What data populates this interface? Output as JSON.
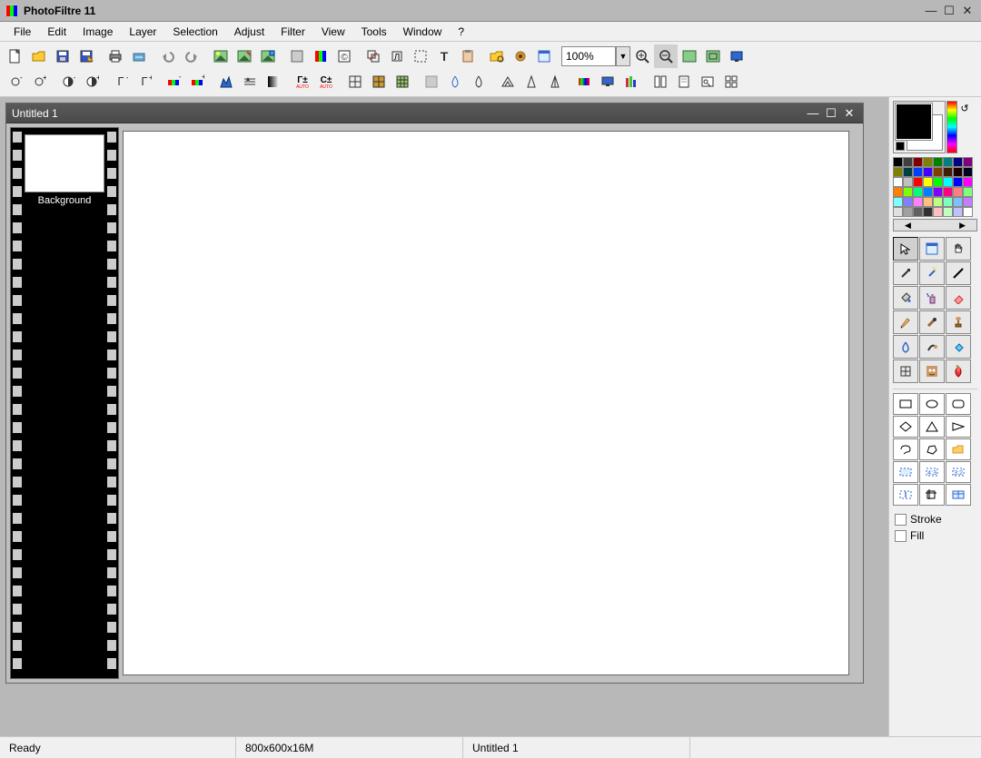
{
  "app": {
    "title": "PhotoFiltre 11"
  },
  "menu": [
    "File",
    "Edit",
    "Image",
    "Layer",
    "Selection",
    "Adjust",
    "Filter",
    "View",
    "Tools",
    "Window",
    "?"
  ],
  "toolbar": {
    "zoom": "100%"
  },
  "document": {
    "title": "Untitled 1",
    "layer_label": "Background"
  },
  "side": {
    "stroke_label": "Stroke",
    "fill_label": "Fill"
  },
  "status": {
    "ready": "Ready",
    "dims": "800x600x16M",
    "file": "Untitled 1"
  },
  "palette_colors": [
    "#000000",
    "#404040",
    "#800000",
    "#808000",
    "#008000",
    "#008080",
    "#000080",
    "#800080",
    "#7f7f00",
    "#003f3f",
    "#003fff",
    "#3f00ff",
    "#7f3f00",
    "#3f1f00",
    "#1f0000",
    "#00001f",
    "#ffffff",
    "#c0c0c0",
    "#ff0000",
    "#ffff00",
    "#00ff00",
    "#00ffff",
    "#0000ff",
    "#ff00ff",
    "#ff7f00",
    "#7fff00",
    "#00ff7f",
    "#007fff",
    "#7f00ff",
    "#ff007f",
    "#ff7f7f",
    "#7fff7f",
    "#7fffff",
    "#7f7fff",
    "#ff7fff",
    "#ffbf7f",
    "#bfff7f",
    "#7fffbf",
    "#7fbfff",
    "#bf7fff",
    "#e0e0e0",
    "#a0a0a0",
    "#606060",
    "#303030",
    "#ffc0c0",
    "#c0ffc0",
    "#c0c0ff",
    "#ffffff"
  ],
  "tools": [
    "pointer",
    "pan-grid",
    "hand",
    "picker",
    "wand",
    "line",
    "bucket",
    "spray",
    "eraser",
    "pencil",
    "brush",
    "stamp",
    "blur",
    "smudge",
    "heal",
    "deform",
    "portrait",
    "strawberry"
  ],
  "shapes": [
    "rect",
    "ellipse",
    "round-rect",
    "diamond",
    "triangle",
    "play",
    "lasso",
    "polygon",
    "folder",
    "sel1",
    "sel2",
    "sel3",
    "text-sel",
    "crop",
    "grid"
  ]
}
